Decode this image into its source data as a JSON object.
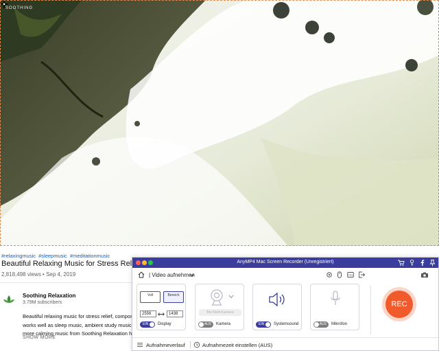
{
  "video": {
    "channel_watermark": "SOOTHING"
  },
  "youtube": {
    "hashtags": [
      "#relaxingmusic",
      "#sleepmusic",
      "#meditationmusic"
    ],
    "title": "Beautiful Relaxing Music for Stress Relief • Me",
    "views_date": "2,818,498 views • Sep 4, 2019",
    "channel_name": "Soothing Relaxation",
    "subscribers": "3.79M subscribers",
    "description_lines": [
      "Beautiful relaxing music for stress relief, compose",
      "works well as sleep music, ambient study music, r",
      "more calming music from Soothing Relaxation he"
    ],
    "show_more": "SHOW MORE"
  },
  "recorder": {
    "window_title": "AnyMP4 Mac Screen Recorder (Unregistriert)",
    "mode_label": "Video aufnehmen",
    "display_card": {
      "full_button": "Voll",
      "region_button": "Bereich",
      "width": "2556",
      "height": "1438",
      "toggle_state": "EIN",
      "label": "Display"
    },
    "camera_card": {
      "select_placeholder": "Bei Nicht-Kamera",
      "toggle_state": "AUS",
      "label": "Kamera"
    },
    "sound_card": {
      "toggle_state": "EIN",
      "label": "Systemsound"
    },
    "mic_card": {
      "toggle_state": "AUS",
      "label": "Mikrofon"
    },
    "rec_button": "REC",
    "history_label": "Aufnahmeverlauf",
    "timer_label": "Aufnahmezeit einstellen (AUS)",
    "colors": {
      "accent": "#3b3d9e",
      "rec": "#f15a2a",
      "toggle_on": "#3b3d9e",
      "toggle_off": "#7d7d7d"
    }
  }
}
